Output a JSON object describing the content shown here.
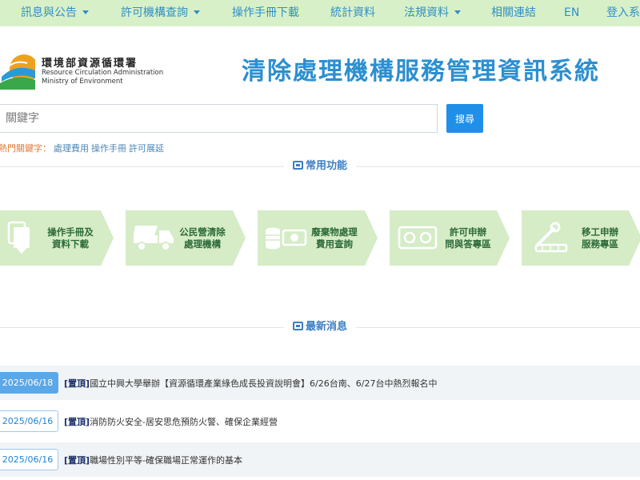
{
  "nav": {
    "items": [
      {
        "label": "訊息與公告",
        "has_menu": true
      },
      {
        "label": "許可機構查詢",
        "has_menu": true
      },
      {
        "label": "操作手冊下載",
        "has_menu": false
      },
      {
        "label": "統計資料",
        "has_menu": false
      },
      {
        "label": "法規資料",
        "has_menu": true
      },
      {
        "label": "相關連結",
        "has_menu": false
      },
      {
        "label": "EN",
        "has_menu": false
      },
      {
        "label": "登入系統",
        "has_menu": false
      }
    ]
  },
  "header": {
    "org_name_zh": "環境部資源循環署",
    "org_name_en_1": "Resource Circulation Administration",
    "org_name_en_2": "Ministry of Environment",
    "system_title": "清除處理機構服務管理資訊系統"
  },
  "search": {
    "placeholder": "關鍵字",
    "button_label": "搜尋",
    "hot_label": "熱門關鍵字：",
    "hot_keywords": [
      "處理費用",
      "操作手冊",
      "許可展延"
    ]
  },
  "sections": {
    "common_title": "常用功能",
    "news_title": "最新消息"
  },
  "features": [
    {
      "line1": "操作手冊及",
      "line2": "資料下載",
      "icon": "document-download-icon"
    },
    {
      "line1": "公民營清除",
      "line2": "處理機構",
      "icon": "dump-truck-icon"
    },
    {
      "line1": "廢棄物處理",
      "line2": "費用查詢",
      "icon": "money-coins-icon"
    },
    {
      "line1": "許可申辦",
      "line2": "問與答專區",
      "icon": "qa-icon"
    },
    {
      "line1": "移工申辦",
      "line2": "服務專區",
      "icon": "worker-tools-icon"
    }
  ],
  "news": [
    {
      "date": "2025/06/18",
      "tag": "[置頂]",
      "text": "國立中興大學舉辦【資源循環產業綠色成長投資說明會】6/26台南、6/27台中熱烈報名中"
    },
    {
      "date": "2025/06/16",
      "tag": "[置頂]",
      "text": "消防防火安全-居安思危預防火警、確保企業經營"
    },
    {
      "date": "2025/06/16",
      "tag": "[置頂]",
      "text": "職場性別平等-確保職場正常運作的基本"
    }
  ],
  "colors": {
    "nav_bg": "#d8f0c8",
    "nav_text": "#2f8fc9",
    "title_blue": "#2b8fd0",
    "tile_bg": "#d5ecc6",
    "tile_text": "#2d6a3a",
    "accent_blue": "#1f8fe8"
  }
}
